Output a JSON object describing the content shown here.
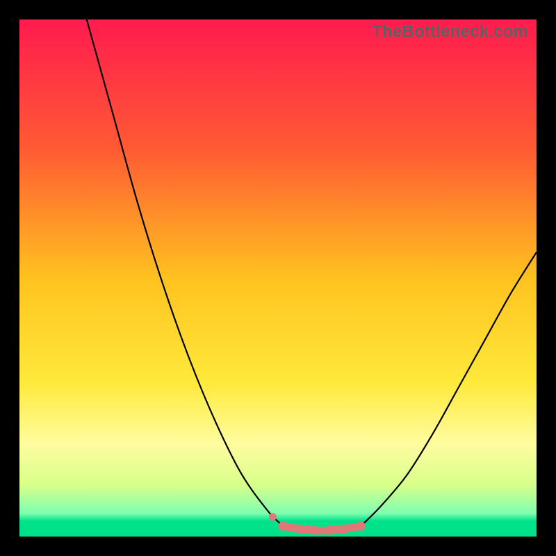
{
  "watermark": "TheBottleneck.com",
  "chart_data": {
    "type": "line",
    "title": "",
    "xlabel": "",
    "ylabel": "",
    "xlim": [
      0,
      100
    ],
    "ylim": [
      0,
      100
    ],
    "gradient_stops": [
      {
        "offset": 0,
        "color": "#ff1b4f"
      },
      {
        "offset": 0.25,
        "color": "#ff5a33"
      },
      {
        "offset": 0.5,
        "color": "#ffc21f"
      },
      {
        "offset": 0.7,
        "color": "#ffe93a"
      },
      {
        "offset": 0.82,
        "color": "#fffca0"
      },
      {
        "offset": 0.9,
        "color": "#d8ff8a"
      },
      {
        "offset": 0.955,
        "color": "#7fffb0"
      },
      {
        "offset": 0.97,
        "color": "#00e28a"
      },
      {
        "offset": 1.0,
        "color": "#00e28a"
      }
    ],
    "series": [
      {
        "name": "left-curve",
        "x": [
          13,
          18,
          23,
          28,
          33,
          38,
          43,
          48,
          51
        ],
        "y": [
          100,
          82,
          64,
          48,
          34,
          22,
          12,
          5,
          2
        ]
      },
      {
        "name": "right-curve",
        "x": [
          66,
          70,
          75,
          80,
          85,
          90,
          95,
          100
        ],
        "y": [
          2,
          6,
          12,
          20,
          29,
          38,
          47,
          55
        ]
      },
      {
        "name": "flat-bottom-dots",
        "x": [
          51,
          54,
          57,
          60,
          63,
          66
        ],
        "y": [
          2,
          1.5,
          1.2,
          1.2,
          1.5,
          2
        ]
      }
    ],
    "marker_color": "#e07878",
    "curve_color": "#000000"
  }
}
